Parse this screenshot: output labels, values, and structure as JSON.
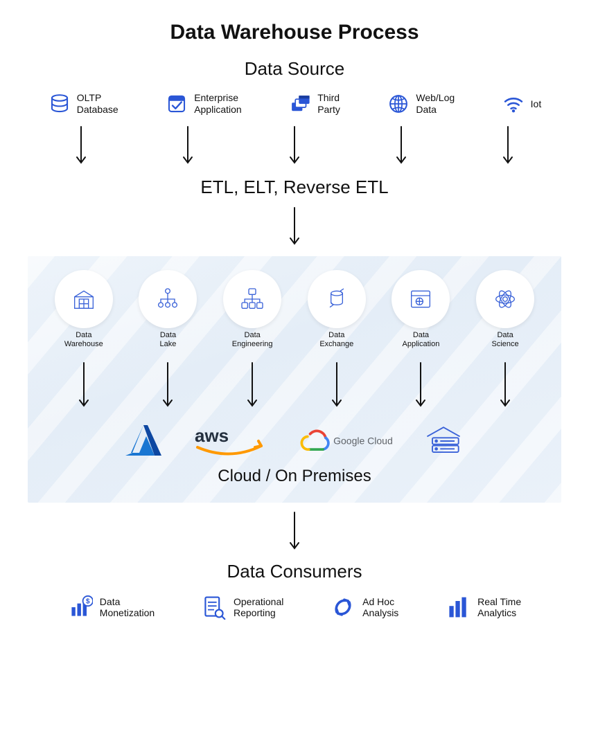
{
  "title": "Data Warehouse Process",
  "sections": {
    "source": "Data Source",
    "etl": "ETL, ELT, Reverse ETL",
    "cloud": "Cloud / On Premises",
    "consumers": "Data Consumers"
  },
  "sources": [
    {
      "label": "OLTP\nDatabase"
    },
    {
      "label": "Enterprise\nApplication"
    },
    {
      "label": "Third\nParty"
    },
    {
      "label": "Web/Log\nData"
    },
    {
      "label": "Iot"
    }
  ],
  "workloads": [
    {
      "label": "Data\nWarehouse"
    },
    {
      "label": "Data\nLake"
    },
    {
      "label": "Data\nEngineering"
    },
    {
      "label": "Data\nExchange"
    },
    {
      "label": "Data\nApplication"
    },
    {
      "label": "Data\nScience"
    }
  ],
  "cloud_vendors": [
    {
      "name": "Azure"
    },
    {
      "name": "AWS"
    },
    {
      "name": "Google Cloud"
    },
    {
      "name": "On-Premises"
    }
  ],
  "consumers": [
    {
      "label": "Data\nMonetization"
    },
    {
      "label": "Operational\nReporting"
    },
    {
      "label": "Ad Hoc\nAnalysis"
    },
    {
      "label": "Real Time\nAnalytics"
    }
  ],
  "colors": {
    "accent": "#2a56d6"
  }
}
